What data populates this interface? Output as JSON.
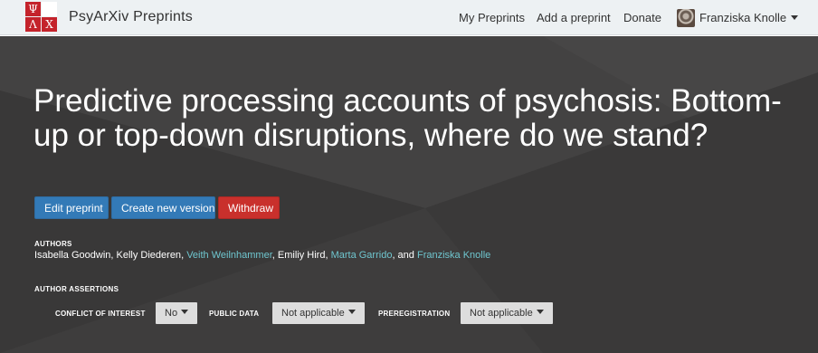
{
  "navbar": {
    "logo_letters": [
      "Ψ",
      "",
      "Λ",
      "Χ"
    ],
    "brand": "PsyArXiv Preprints",
    "links": {
      "my_preprints": "My Preprints",
      "add_preprint": "Add a preprint",
      "donate": "Donate"
    },
    "user_name": "Franziska Knolle"
  },
  "preprint": {
    "title": "Predictive processing accounts of psychosis: Bottom-up or top-down disruptions, where do we stand?",
    "actions": {
      "edit": "Edit preprint",
      "new_version": "Create new version",
      "withdraw": "Withdraw"
    },
    "authors_label": "AUTHORS",
    "authors": [
      {
        "name": "Isabella Goodwin",
        "sep": ", ",
        "linked": false
      },
      {
        "name": "Kelly Diederen",
        "sep": ", ",
        "linked": false
      },
      {
        "name": "Veith Weilnhammer",
        "sep": ", ",
        "linked": true
      },
      {
        "name": "Emiliy Hird",
        "sep": ", ",
        "linked": false
      },
      {
        "name": "Marta Garrido",
        "sep": ", and ",
        "linked": true
      },
      {
        "name": "Franziska Knolle",
        "sep": "",
        "linked": true
      }
    ],
    "assertions_label": "AUTHOR ASSERTIONS",
    "assertions": {
      "coi_label": "CONFLICT OF INTEREST",
      "coi_value": "No",
      "data_label": "PUBLIC DATA",
      "data_value": "Not applicable",
      "prereg_label": "PREREGISTRATION",
      "prereg_value": "Not applicable"
    }
  },
  "colors": {
    "hero_bg": "#3e3d3d",
    "primary_button": "#337ab7",
    "danger_button": "#c9302c",
    "author_link": "#6fc6cf",
    "logo_red": "#c4232b"
  }
}
